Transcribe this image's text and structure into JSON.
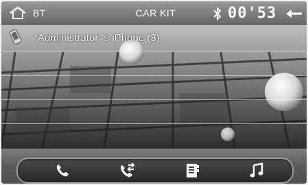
{
  "topbar": {
    "mode_label": "BT",
    "title": "CAR KIT",
    "clock": "00'53",
    "home_icon": "home-icon",
    "bluetooth_icon": "bluetooth-icon",
    "back_icon": "back-arrow-icon"
  },
  "device": {
    "icon": "phone-icon",
    "name": "“Administrator”‘s iPhone (3)"
  },
  "bottom_bar": {
    "buttons": [
      {
        "name": "call-icon"
      },
      {
        "name": "call-transfer-icon"
      },
      {
        "name": "contacts-book-icon"
      },
      {
        "name": "music-note-icon"
      }
    ]
  },
  "colors": {
    "bar_gray": "#7b7b7b",
    "text_white": "#ffffff",
    "accent_dark": "#262626"
  }
}
